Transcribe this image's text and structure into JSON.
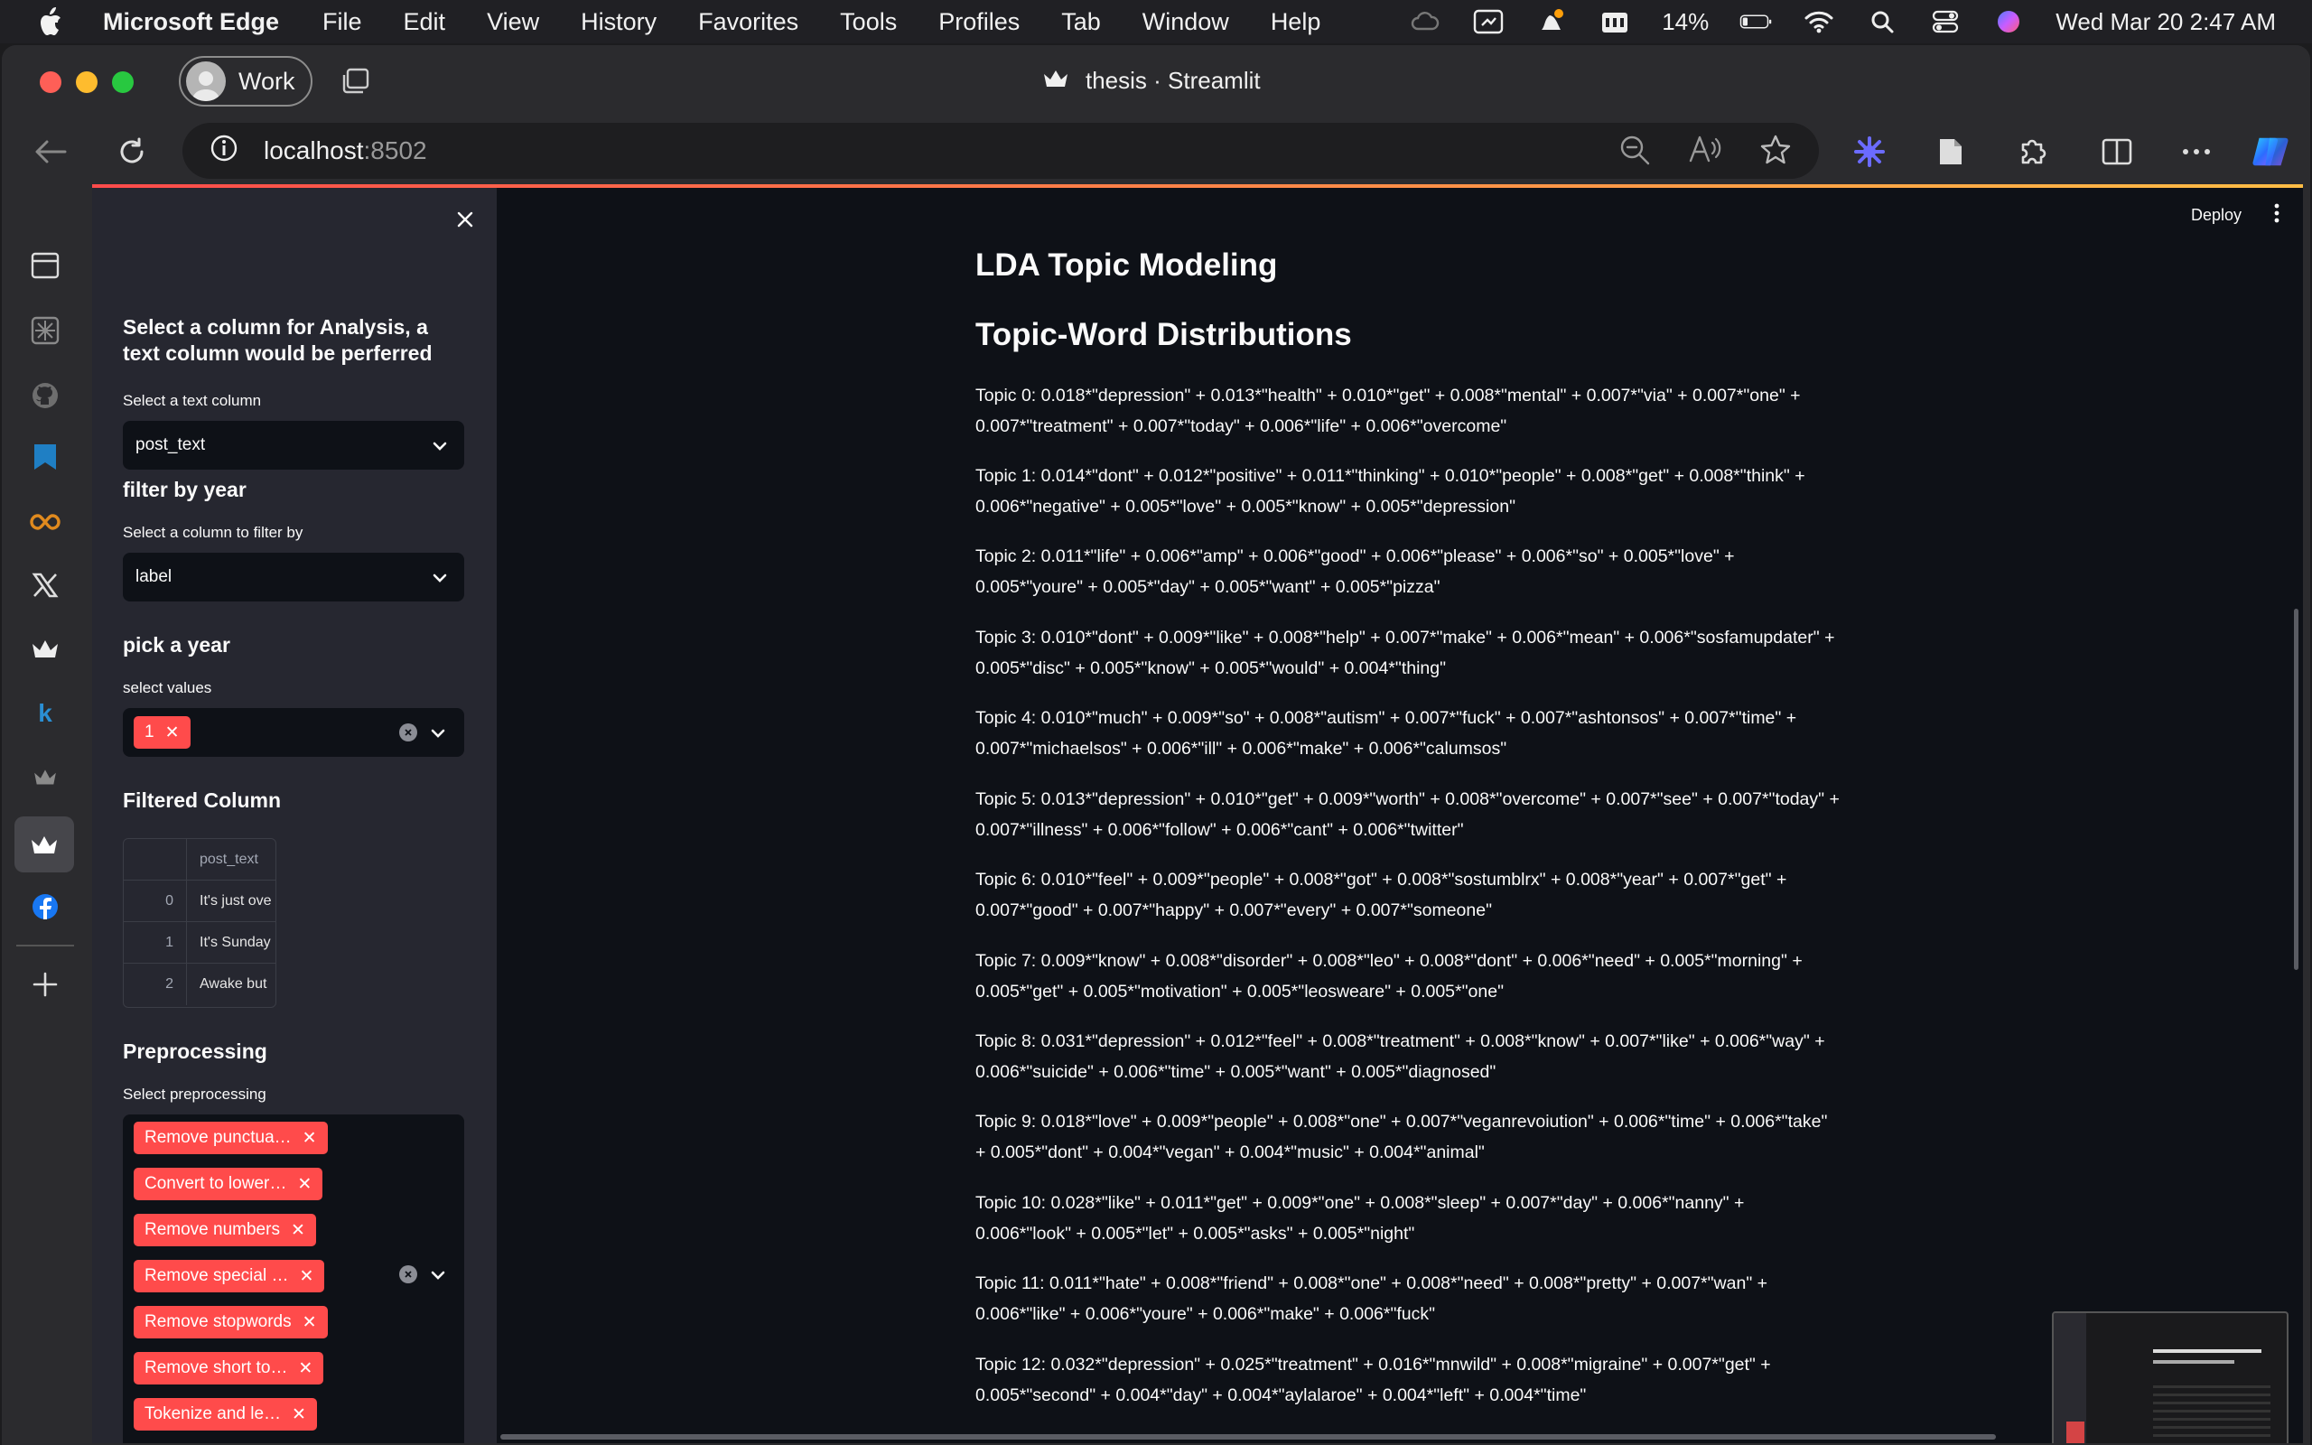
{
  "menubar": {
    "app_name": "Microsoft Edge",
    "items": [
      "File",
      "Edit",
      "View",
      "History",
      "Favorites",
      "Tools",
      "Profiles",
      "Tab",
      "Window",
      "Help"
    ],
    "battery": "14%",
    "datetime": "Wed Mar 20  2:47 AM"
  },
  "browser": {
    "profile_label": "Work",
    "tab_title": "thesis · Streamlit",
    "url_host": "localhost",
    "url_port": ":8502"
  },
  "app": {
    "deploy_label": "Deploy",
    "sidebar": {
      "column_heading": "Select a column for Analysis, a text column would be perferred",
      "text_column_label": "Select a text column",
      "text_column_value": "post_text",
      "filter_heading": "filter by year",
      "filter_column_label": "Select a column to filter by",
      "filter_column_value": "label",
      "year_heading": "pick a year",
      "values_label": "select values",
      "selected_values": [
        "1"
      ],
      "filtered_heading": "Filtered Column",
      "table": {
        "column": "post_text",
        "rows": [
          {
            "index": "0",
            "text": "It's just ove"
          },
          {
            "index": "1",
            "text": "It's Sunday"
          },
          {
            "index": "2",
            "text": "Awake but"
          }
        ]
      },
      "preprocessing_heading": "Preprocessing",
      "preprocessing_label": "Select preprocessing",
      "preprocessing_chips": [
        "Remove punctua…",
        "Convert to lower…",
        "Remove numbers",
        "Remove special …",
        "Remove stopwords",
        "Remove short to…",
        "Tokenize and le…"
      ]
    },
    "main": {
      "title": "LDA Topic Modeling",
      "subtitle": "Topic-Word Distributions",
      "topics": [
        "Topic 0: 0.018*\"depression\" + 0.013*\"health\" + 0.010*\"get\" + 0.008*\"mental\" + 0.007*\"via\" + 0.007*\"one\" + 0.007*\"treatment\" + 0.007*\"today\" + 0.006*\"life\" + 0.006*\"overcome\"",
        "Topic 1: 0.014*\"dont\" + 0.012*\"positive\" + 0.011*\"thinking\" + 0.010*\"people\" + 0.008*\"get\" + 0.008*\"think\" + 0.006*\"negative\" + 0.005*\"love\" + 0.005*\"know\" + 0.005*\"depression\"",
        "Topic 2: 0.011*\"life\" + 0.006*\"amp\" + 0.006*\"good\" + 0.006*\"please\" + 0.006*\"so\" + 0.005*\"love\" + 0.005*\"youre\" + 0.005*\"day\" + 0.005*\"want\" + 0.005*\"pizza\"",
        "Topic 3: 0.010*\"dont\" + 0.009*\"like\" + 0.008*\"help\" + 0.007*\"make\" + 0.006*\"mean\" + 0.006*\"sosfamupdater\" + 0.005*\"disc\" + 0.005*\"know\" + 0.005*\"would\" + 0.004*\"thing\"",
        "Topic 4: 0.010*\"much\" + 0.009*\"so\" + 0.008*\"autism\" + 0.007*\"fuck\" + 0.007*\"ashtonsos\" + 0.007*\"time\" + 0.007*\"michaelsos\" + 0.006*\"ill\" + 0.006*\"make\" + 0.006*\"calumsos\"",
        "Topic 5: 0.013*\"depression\" + 0.010*\"get\" + 0.009*\"worth\" + 0.008*\"overcome\" + 0.007*\"see\" + 0.007*\"today\" + 0.007*\"illness\" + 0.006*\"follow\" + 0.006*\"cant\" + 0.006*\"twitter\"",
        "Topic 6: 0.010*\"feel\" + 0.009*\"people\" + 0.008*\"got\" + 0.008*\"sostumblrx\" + 0.008*\"year\" + 0.007*\"get\" + 0.007*\"good\" + 0.007*\"happy\" + 0.007*\"every\" + 0.007*\"someone\"",
        "Topic 7: 0.009*\"know\" + 0.008*\"disorder\" + 0.008*\"leo\" + 0.008*\"dont\" + 0.006*\"need\" + 0.005*\"morning\" + 0.005*\"get\" + 0.005*\"motivation\" + 0.005*\"leosweare\" + 0.005*\"one\"",
        "Topic 8: 0.031*\"depression\" + 0.012*\"feel\" + 0.008*\"treatment\" + 0.008*\"know\" + 0.007*\"like\" + 0.006*\"way\" + 0.006*\"suicide\" + 0.006*\"time\" + 0.005*\"want\" + 0.005*\"diagnosed\"",
        "Topic 9: 0.018*\"love\" + 0.009*\"people\" + 0.008*\"one\" + 0.007*\"veganrevoiution\" + 0.006*\"time\" + 0.006*\"take\" + 0.005*\"dont\" + 0.004*\"vegan\" + 0.004*\"music\" + 0.004*\"animal\"",
        "Topic 10: 0.028*\"like\" + 0.011*\"get\" + 0.009*\"one\" + 0.008*\"sleep\" + 0.007*\"day\" + 0.006*\"nanny\" + 0.006*\"look\" + 0.005*\"let\" + 0.005*\"asks\" + 0.005*\"night\"",
        "Topic 11: 0.011*\"hate\" + 0.008*\"friend\" + 0.008*\"one\" + 0.008*\"need\" + 0.008*\"pretty\" + 0.007*\"wan\" + 0.006*\"like\" + 0.006*\"youre\" + 0.006*\"make\" + 0.006*\"fuck\"",
        "Topic 12: 0.032*\"depression\" + 0.025*\"treatment\" + 0.016*\"mnwild\" + 0.008*\"migraine\" + 0.007*\"get\" + 0.005*\"second\" + 0.004*\"day\" + 0.004*\"aylalaroe\" + 0.004*\"left\" + 0.004*\"time\""
      ]
    }
  },
  "colors": {
    "accent": "#ff4b4b",
    "app_bg": "#0e1117",
    "sidebar_bg": "#262730",
    "browser_chrome": "#2b2b2e"
  }
}
